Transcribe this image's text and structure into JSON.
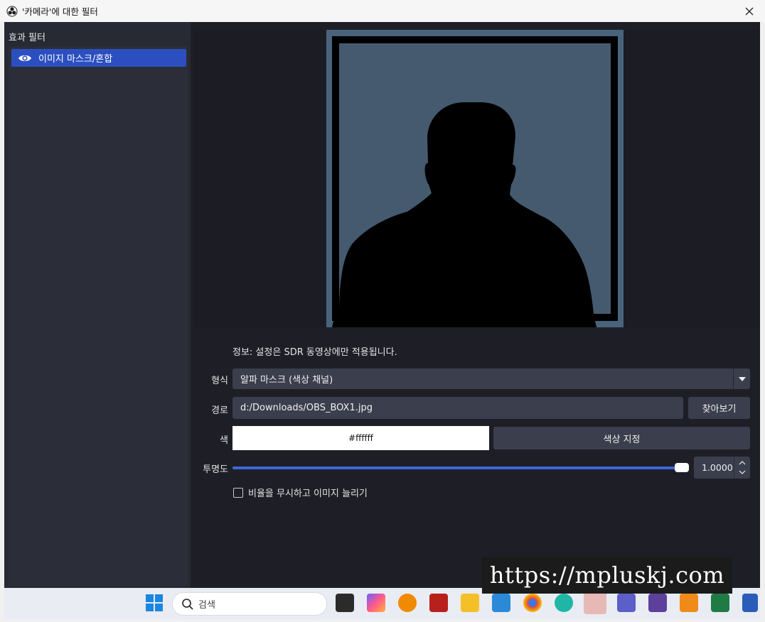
{
  "window": {
    "title": "'카메라'에 대한 필터"
  },
  "left_panel": {
    "title": "효과 필터",
    "filters": [
      {
        "label": "이미지 마스크/혼합",
        "visible": true,
        "selected": true
      }
    ]
  },
  "form": {
    "info": "정보: 설정은 SDR 동영상에만 적용됩니다.",
    "type": {
      "label": "형식",
      "value": "알파 마스크 (색상 채널)"
    },
    "path": {
      "label": "경로",
      "value": "d:/Downloads/OBS_BOX1.jpg",
      "browse_label": "찾아보기"
    },
    "color": {
      "label": "색",
      "value": "#ffffff",
      "swatch_color": "#ffffff",
      "button_label": "색상 지정"
    },
    "opacity": {
      "label": "투명도",
      "value": "1.0000",
      "fraction": 1.0
    },
    "stretch": {
      "label": "비율을 무시하고 이미지 늘리기",
      "checked": false
    }
  },
  "taskbar": {
    "search_label": "검색"
  },
  "watermark": "https://mpluskj.com",
  "colors": {
    "accent": "#2c4fc0",
    "slider": "#3f67d8",
    "panel": "#272a33",
    "background": "#1e1f26",
    "mask_frame": "#4a637c"
  }
}
